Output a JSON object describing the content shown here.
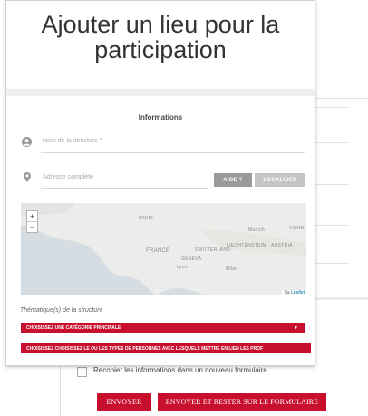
{
  "modal": {
    "title": "Ajouter un lieu pour la participation",
    "section_title": "Informations",
    "structure_name_placeholder": "Nom de la structure *",
    "address_placeholder": "Adresse complète",
    "help_button": "AIDE ?",
    "locate_button": "LOCALISER",
    "map": {
      "zoom_in": "+",
      "zoom_out": "−",
      "labels": [
        "PARIS",
        "FRANCE",
        "Munich",
        "VIENN",
        "LIECHTENSTEIN",
        "AUSTRIA",
        "SWITZERLAND",
        "GENEVA",
        "Lyon",
        "Milan"
      ],
      "attribution_prefix": "Sa",
      "attribution_link": "Leaflet"
    },
    "thematic_label": "Thématique(s) de la structure",
    "category_select": "CHOISISSEZ UNE CATÉGORIE PRINCIPALE",
    "persons_select": "CHOISISSEZ CHOISISSEZ LE OU LES TYPES DE PERSONNES AVEC LESQUELS METTRE EN LIEN LES PROF",
    "caret": "▼"
  },
  "background_form": {
    "copy_checkbox_label": "Recopier les informations dans un nouveau formulaire",
    "send_button": "ENVOYER",
    "send_stay_button": "ENVOYER ET RESTER SUR LE FORMULAIRE"
  },
  "icons": {
    "user": "user-icon",
    "location": "map-pin-icon"
  },
  "colors": {
    "accent_red": "#c8102e",
    "grey_button": "#9a9a9a"
  }
}
